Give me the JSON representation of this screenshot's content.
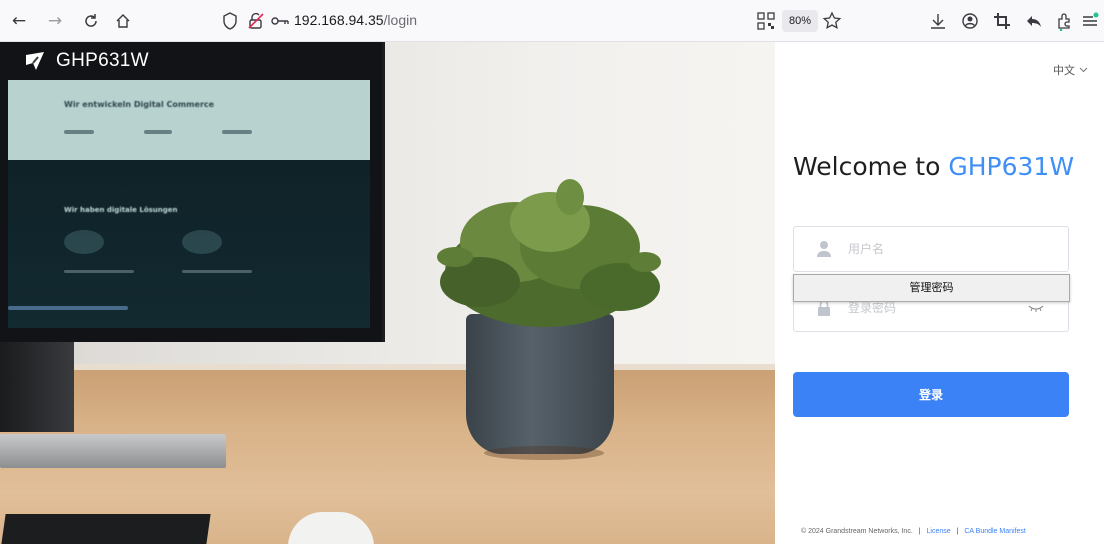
{
  "browser": {
    "url_host": "192.168.94.35",
    "url_path": "/login",
    "zoom": "80%"
  },
  "brand": {
    "name": "GHP631W"
  },
  "screen_text": {
    "headline": "Wir entwickeln Digital Commerce",
    "section": "Wir haben digitale Lösungen"
  },
  "login": {
    "language": "中文",
    "welcome_prefix": "Welcome to",
    "welcome_model": "GHP631W",
    "username_placeholder": "用户名",
    "password_placeholder": "登录密码",
    "autocomplete_suggestion": "管理密码",
    "login_label": "登录"
  },
  "footer": {
    "copyright": "© 2024 Grandstream Networks, Inc.",
    "separator": "|",
    "license": "License",
    "ca_bundle": "CA Bundle Manifest"
  },
  "colors": {
    "accent": "#3b82f6",
    "model_text": "#3f8ff4"
  }
}
